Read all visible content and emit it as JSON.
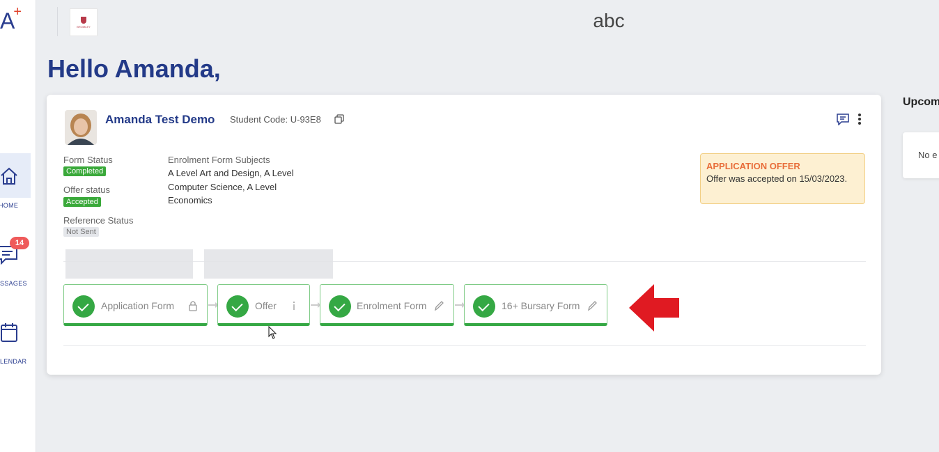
{
  "app": {
    "logo_text": "A",
    "logo_plus": "+",
    "page_title": "abc",
    "school_logo_text": "BROMLEY"
  },
  "sidebar": {
    "items": [
      {
        "label": "HOME",
        "icon": "home-icon"
      },
      {
        "label": "SSAGES",
        "icon": "messages-icon",
        "badge": "14"
      },
      {
        "label": "LENDAR",
        "icon": "calendar-icon"
      }
    ]
  },
  "greeting": "Hello Amanda,",
  "student": {
    "name": "Amanda Test Demo",
    "code_label": "Student Code: U-93E8",
    "form_status_label": "Form Status",
    "form_status_value": "Completed",
    "offer_status_label": "Offer status",
    "offer_status_value": "Accepted",
    "reference_status_label": "Reference Status",
    "reference_status_value": "Not Sent",
    "subjects_label": "Enrolment Form Subjects",
    "subjects_value": "A Level Art and Design, A Level Computer Science, A Level Economics"
  },
  "offer_notice": {
    "title": "APPLICATION OFFER",
    "text": "Offer was accepted on 15/03/2023."
  },
  "steps": [
    {
      "name": "Application Form",
      "status": "complete",
      "action_icon": "lock-icon"
    },
    {
      "name": "Offer",
      "status": "complete",
      "action_icon": "info-icon"
    },
    {
      "name": "Enrolment Form",
      "status": "complete",
      "action_icon": "pencil-icon"
    },
    {
      "name": "16+ Bursary Form",
      "status": "complete",
      "action_icon": "pencil-icon"
    }
  ],
  "right_panel": {
    "title": "Upcom",
    "empty_text": "No e"
  },
  "colors": {
    "brand_blue": "#233a88",
    "success_green": "#35a844",
    "badge_red": "#ef5a5a",
    "offer_orange": "#e86d3a",
    "arrow_red": "#e01a22"
  }
}
